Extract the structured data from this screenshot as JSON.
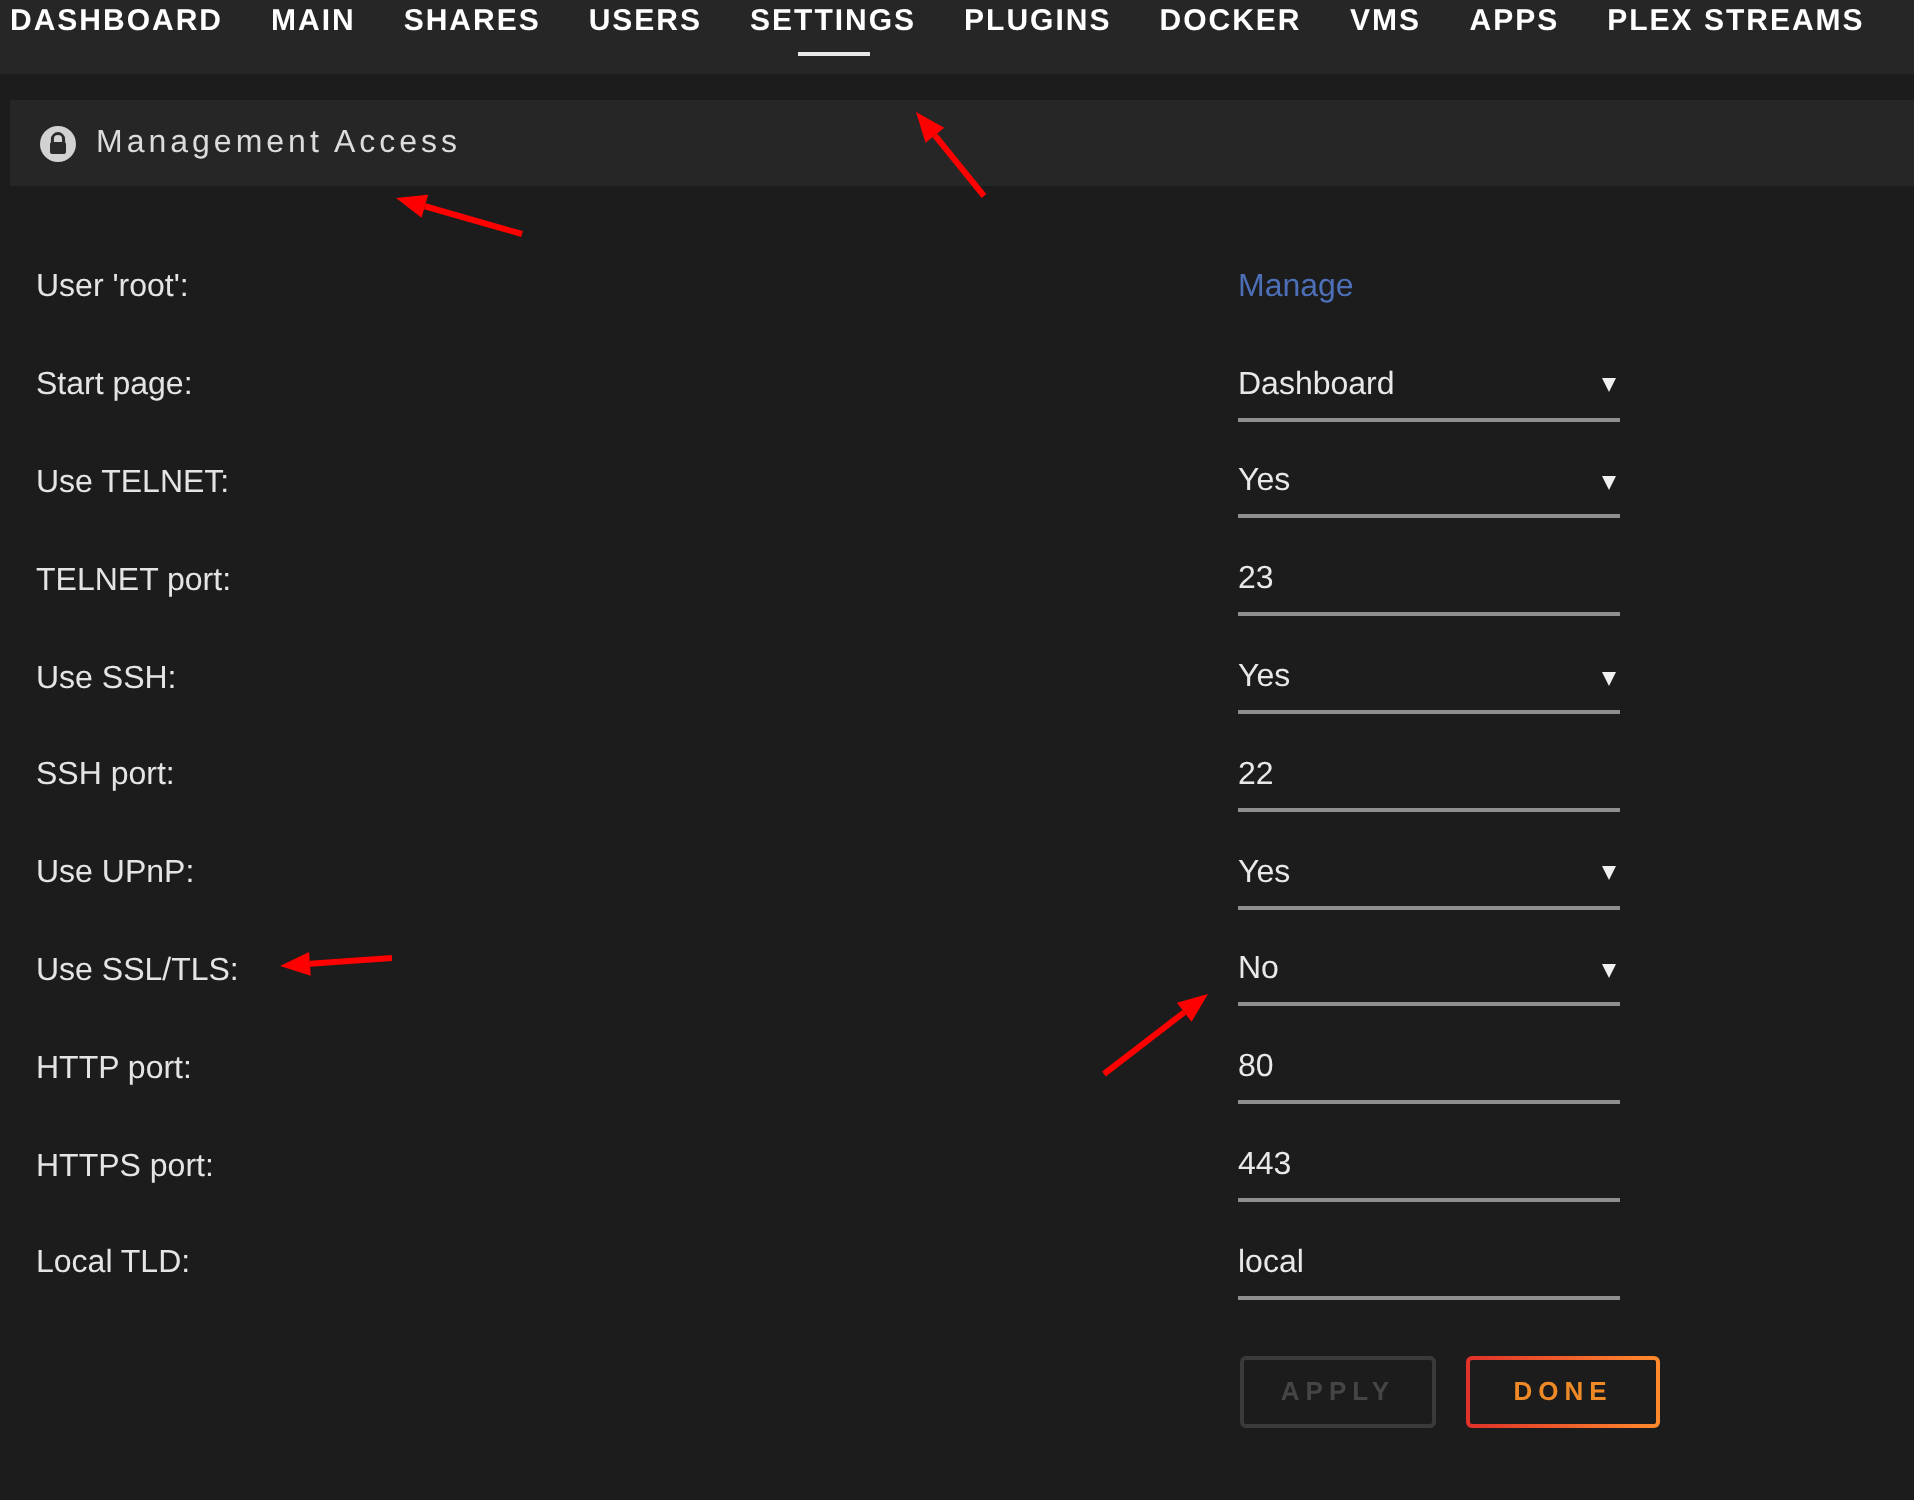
{
  "nav": {
    "tabs": [
      {
        "label": "DASHBOARD",
        "selected": false
      },
      {
        "label": "MAIN",
        "selected": false
      },
      {
        "label": "SHARES",
        "selected": false
      },
      {
        "label": "USERS",
        "selected": false
      },
      {
        "label": "SETTINGS",
        "selected": true
      },
      {
        "label": "PLUGINS",
        "selected": false
      },
      {
        "label": "DOCKER",
        "selected": false
      },
      {
        "label": "VMS",
        "selected": false
      },
      {
        "label": "APPS",
        "selected": false
      },
      {
        "label": "PLEX STREAMS",
        "selected": false
      }
    ]
  },
  "section": {
    "title": "Management Access"
  },
  "fields": [
    {
      "label": "User 'root':",
      "kind": "link",
      "value": "Manage"
    },
    {
      "label": "Start page:",
      "kind": "select",
      "value": "Dashboard"
    },
    {
      "label": "Use TELNET:",
      "kind": "select",
      "value": "Yes"
    },
    {
      "label": "TELNET port:",
      "kind": "input",
      "value": "23"
    },
    {
      "label": "Use SSH:",
      "kind": "select",
      "value": "Yes"
    },
    {
      "label": "SSH port:",
      "kind": "input",
      "value": "22"
    },
    {
      "label": "Use UPnP:",
      "kind": "select",
      "value": "Yes"
    },
    {
      "label": "Use SSL/TLS:",
      "kind": "select",
      "value": "No"
    },
    {
      "label": "HTTP port:",
      "kind": "input",
      "value": "80"
    },
    {
      "label": "HTTPS port:",
      "kind": "input",
      "value": "443"
    },
    {
      "label": "Local TLD:",
      "kind": "input",
      "value": "local"
    }
  ],
  "buttons": [
    {
      "label": "APPLY",
      "disabled": true
    },
    {
      "label": "DONE",
      "disabled": false
    }
  ]
}
